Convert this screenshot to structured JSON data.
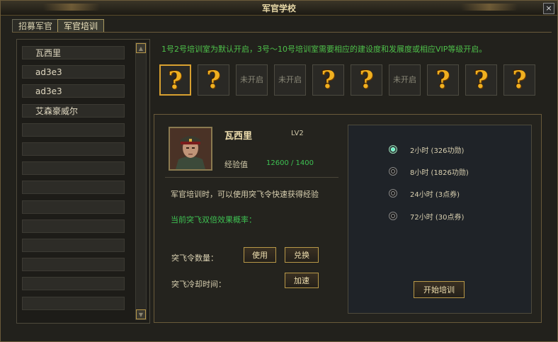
{
  "window": {
    "title": "军官学校",
    "close_label": "×"
  },
  "tabs": [
    {
      "label": "招募军官"
    },
    {
      "label": "军官培训"
    }
  ],
  "officer_list": [
    "瓦西里",
    "ad3e3",
    "ad3e3",
    "艾森豪威尔",
    "",
    "",
    "",
    "",
    "",
    "",
    "",
    "",
    "",
    ""
  ],
  "scroll": {
    "up": "▲",
    "down": "▼"
  },
  "notice": "1号2号培训室为默认开启，3号～10号培训室需要相应的建设度和发展度或相应VIP等级开启。",
  "rooms": [
    {
      "state": "available",
      "label": "?"
    },
    {
      "state": "available",
      "label": "?"
    },
    {
      "state": "locked",
      "label": "未开启"
    },
    {
      "state": "locked",
      "label": "未开启"
    },
    {
      "state": "available",
      "label": "?"
    },
    {
      "state": "available",
      "label": "?"
    },
    {
      "state": "locked",
      "label": "未开启"
    },
    {
      "state": "available",
      "label": "?"
    },
    {
      "state": "available",
      "label": "?"
    },
    {
      "state": "available",
      "label": "?"
    }
  ],
  "officer": {
    "name": "瓦西里",
    "level": "LV2",
    "exp_label": "经验值",
    "exp_value": "12600 / 1400"
  },
  "desc": "军官培训时，可以使用突飞令快速获得经验",
  "rate_label": "当前突飞双倍效果概率：",
  "token_label": "突飞令数量：",
  "use_label": "使用",
  "exchange_label": "兑换",
  "cooldown_label": "突飞冷却时间：",
  "speedup_label": "加速",
  "options": [
    {
      "label": "2小时 (326功勋)",
      "selected": true
    },
    {
      "label": "8小时 (1826功勋)",
      "selected": false
    },
    {
      "label": "24小时 (3点券)",
      "selected": false
    },
    {
      "label": "72小时 (30点券)",
      "selected": false
    }
  ],
  "start_label": "开始培训",
  "colors": {
    "accent": "#f0b020",
    "green": "#3ec052",
    "gold_border": "#b89848"
  }
}
